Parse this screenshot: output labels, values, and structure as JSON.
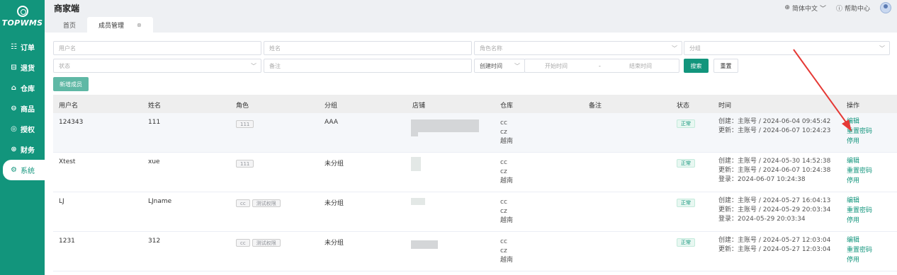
{
  "app": {
    "logo_text": "TOPWMS",
    "title": "商家端"
  },
  "sidebar": {
    "items": [
      {
        "label": "订单",
        "icon": "order-icon"
      },
      {
        "label": "退货",
        "icon": "return-icon"
      },
      {
        "label": "仓库",
        "icon": "warehouse-icon"
      },
      {
        "label": "商品",
        "icon": "goods-icon"
      },
      {
        "label": "授权",
        "icon": "auth-icon"
      },
      {
        "label": "财务",
        "icon": "finance-icon"
      },
      {
        "label": "系统",
        "icon": "settings-icon"
      }
    ]
  },
  "header": {
    "language": "简体中文",
    "help": "帮助中心"
  },
  "tabs": [
    {
      "label": "首页"
    },
    {
      "label": "成员管理"
    }
  ],
  "filters": {
    "username_ph": "用户名",
    "name_ph": "姓名",
    "role_ph": "角色名称",
    "group_ph": "分组",
    "status_ph": "状态",
    "remark_ph": "备注",
    "time_type": "创建时间",
    "start_ph": "开始时间",
    "sep": "-",
    "end_ph": "结束时间",
    "search_btn": "搜索",
    "reset_btn": "重置"
  },
  "add_button": "新增成员",
  "columns": [
    "用户名",
    "姓名",
    "角色",
    "分组",
    "店铺",
    "仓库",
    "备注",
    "状态",
    "时间",
    "操作"
  ],
  "rows": [
    {
      "username": "124343",
      "name": "111",
      "tags": [
        "111"
      ],
      "group": "AAA",
      "warehouses": [
        "cc",
        "cz",
        "越南"
      ],
      "status": "正常",
      "times": [
        "创建：主账号 / 2024-06-04 09:45:42",
        "更新：主账号 / 2024-06-07 10:24:23"
      ],
      "ops": [
        "编辑",
        "重置密码",
        "停用"
      ]
    },
    {
      "username": "Xtest",
      "name": "xue",
      "tags": [
        "111"
      ],
      "group": "未分组",
      "warehouses": [
        "cc",
        "cz",
        "越南"
      ],
      "status": "正常",
      "times": [
        "创建：主账号 / 2024-05-30 14:52:38",
        "更新：主账号 / 2024-06-07 10:24:38",
        "登录：2024-06-07 10:24:38"
      ],
      "ops": [
        "编辑",
        "重置密码",
        "停用"
      ]
    },
    {
      "username": "LJ",
      "name": "LJname",
      "tags": [
        "cc",
        "测试权限"
      ],
      "group": "未分组",
      "warehouses": [
        "cc",
        "cz",
        "越南"
      ],
      "status": "正常",
      "times": [
        "创建：主账号 / 2024-05-27 16:04:13",
        "更新：主账号 / 2024-05-29 20:03:34",
        "登录：2024-05-29 20:03:34"
      ],
      "ops": [
        "编辑",
        "重置密码",
        "停用"
      ]
    },
    {
      "username": "1231",
      "name": "312",
      "tags": [
        "cc",
        "测试权限"
      ],
      "group": "未分组",
      "warehouses": [
        "cc",
        "cz",
        "越南"
      ],
      "status": "正常",
      "times": [
        "创建：主账号 / 2024-05-27 12:03:04",
        "更新：主账号 / 2024-05-27 12:03:04"
      ],
      "ops": [
        "编辑",
        "重置密码",
        "停用"
      ]
    }
  ],
  "colors": {
    "brand": "#12957c",
    "annotation_arrow": "#e53935"
  }
}
